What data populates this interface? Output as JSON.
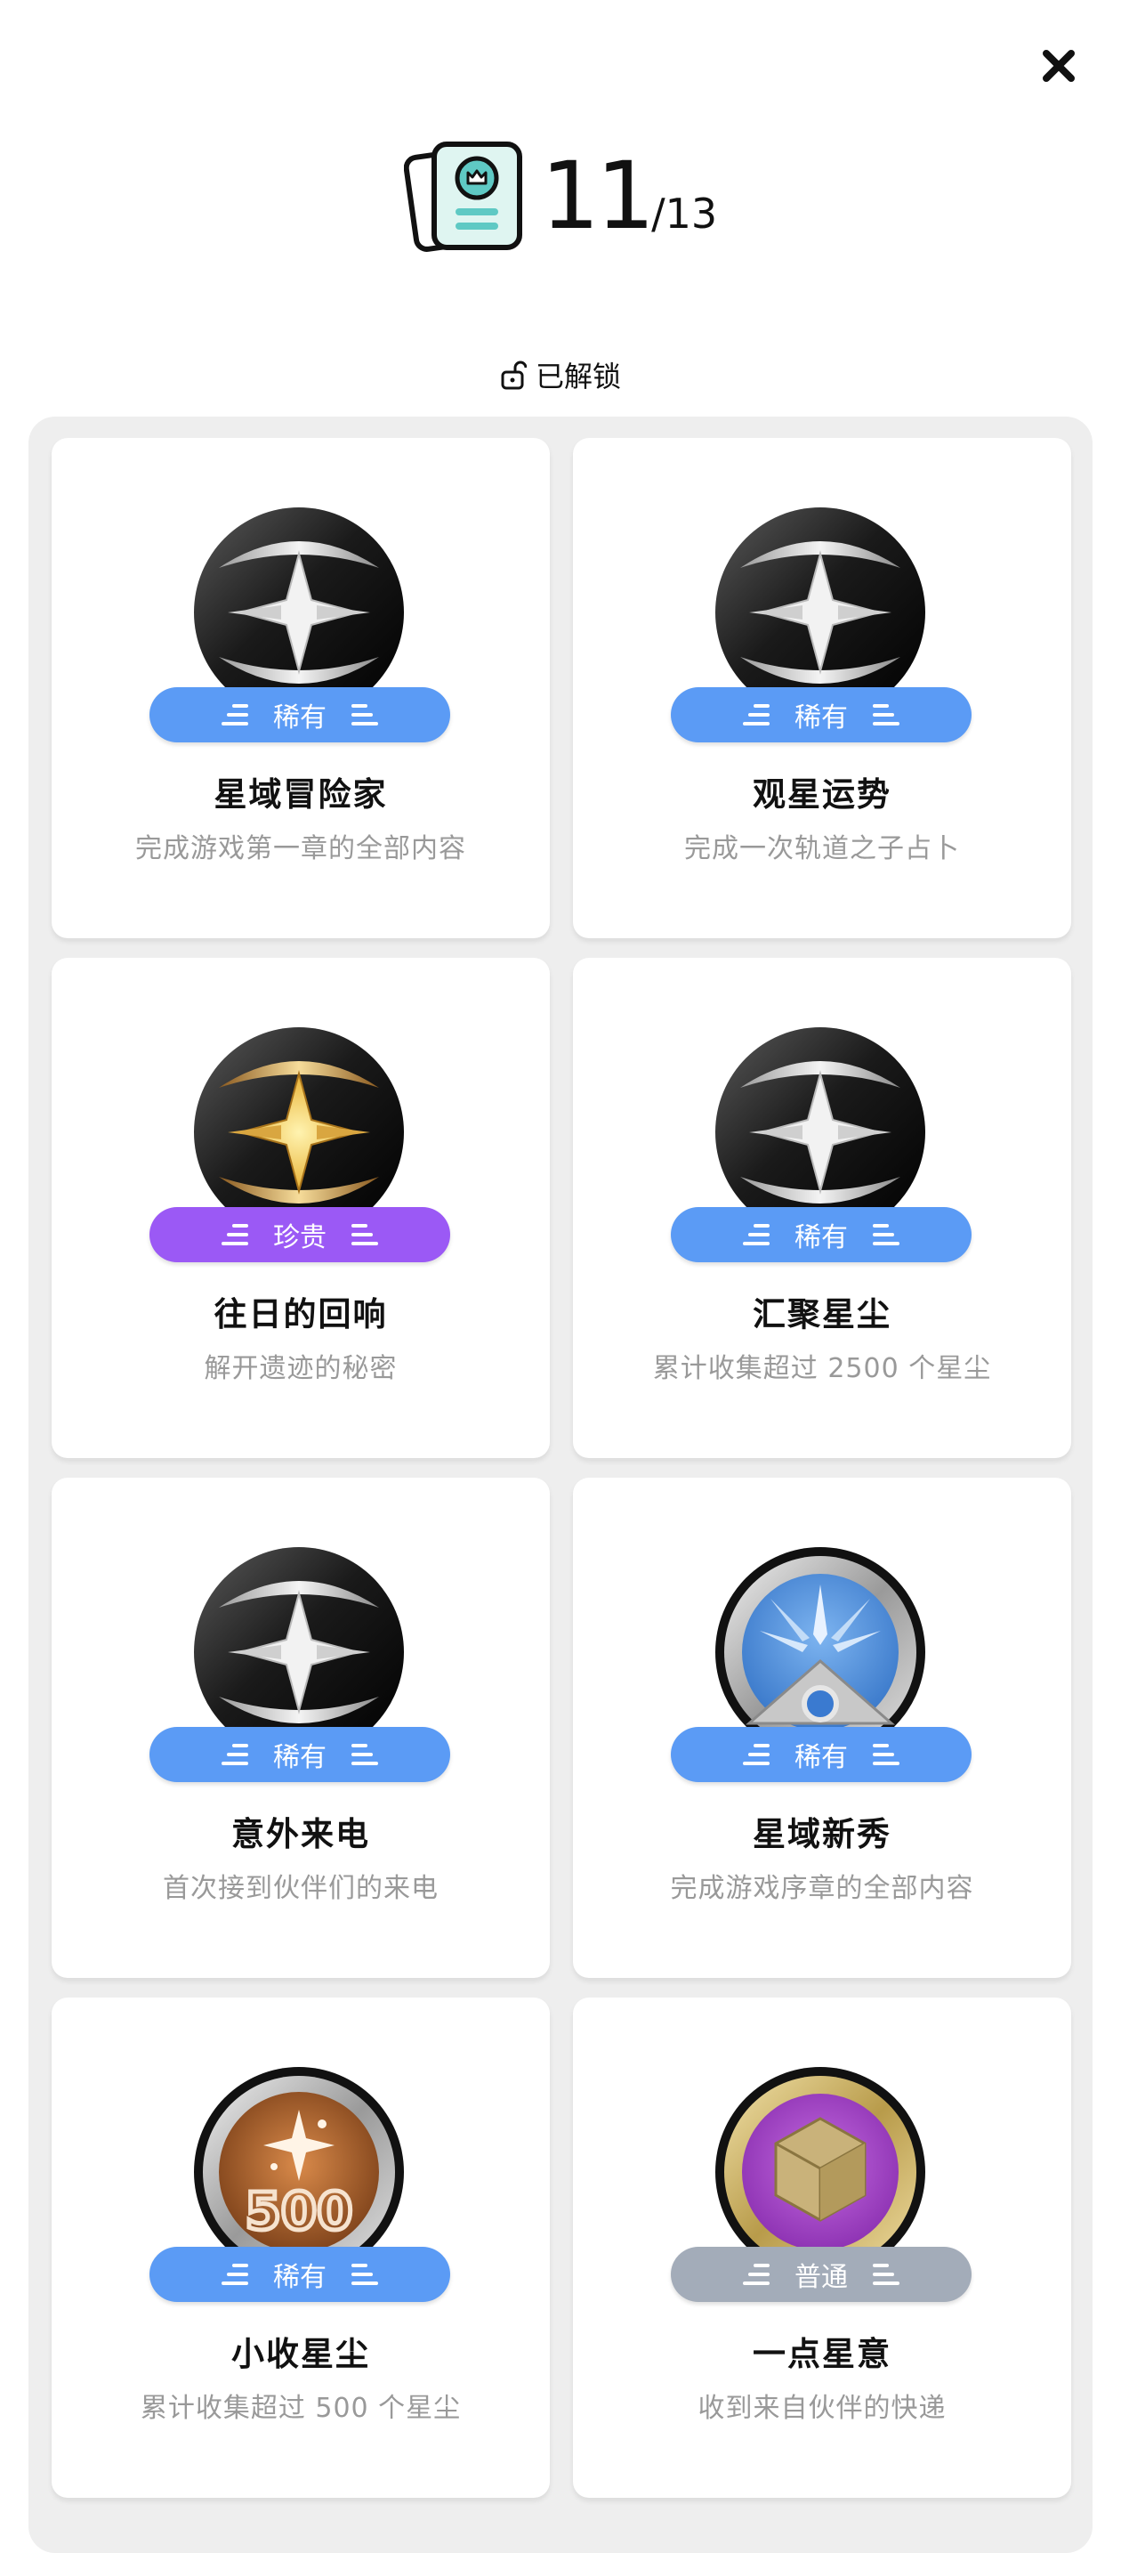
{
  "header": {
    "unlocked_count": "11",
    "total": "/13",
    "icon": "achievement-cards-icon"
  },
  "close": {
    "icon": "close-icon"
  },
  "status": {
    "label": "已解锁",
    "icon": "unlocked-padlock-icon"
  },
  "colors": {
    "rare": "#5b9bf5",
    "precious": "#9b59f5",
    "common": "#a3acb9",
    "panel": "#eeeeee"
  },
  "achievements": [
    {
      "title": "星域冒险家",
      "desc": "完成游戏第一章的全部内容",
      "rarity": "稀有",
      "medal": "silver-star-medal-icon"
    },
    {
      "title": "观星运势",
      "desc": "完成一次轨道之子占卜",
      "rarity": "稀有",
      "medal": "silver-star-medal-icon"
    },
    {
      "title": "往日的回响",
      "desc": "解开遗迹的秘密",
      "rarity": "珍贵",
      "medal": "gold-star-medal-icon"
    },
    {
      "title": "汇聚星尘",
      "desc": "累计收集超过 2500 个星尘",
      "rarity": "稀有",
      "medal": "silver-star-medal-icon"
    },
    {
      "title": "意外来电",
      "desc": "首次接到伙伴们的来电",
      "rarity": "稀有",
      "medal": "silver-star-medal-icon"
    },
    {
      "title": "星域新秀",
      "desc": "完成游戏序章的全部内容",
      "rarity": "稀有",
      "medal": "blue-compass-medal-icon"
    },
    {
      "title": "小收星尘",
      "desc": "累计收集超过 500 个星尘",
      "rarity": "稀有",
      "medal": "bronze-500-medal-icon",
      "medal_text": "500"
    },
    {
      "title": "一点星意",
      "desc": "收到来自伙伴的快递",
      "rarity": "普通",
      "medal": "purple-cube-medal-icon"
    }
  ]
}
